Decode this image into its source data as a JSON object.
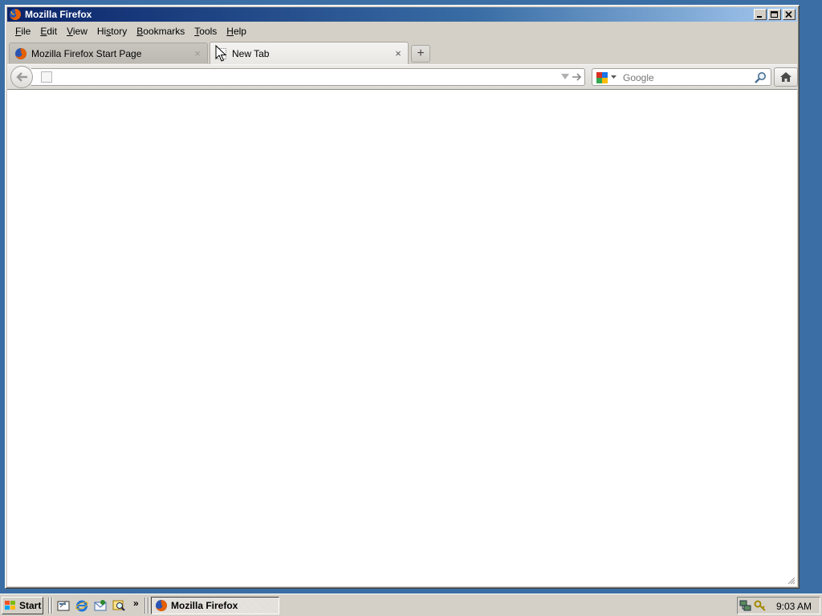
{
  "window": {
    "title": "Mozilla Firefox"
  },
  "menu": [
    {
      "pre": "",
      "u": "F",
      "post": "ile"
    },
    {
      "pre": "",
      "u": "E",
      "post": "dit"
    },
    {
      "pre": "",
      "u": "V",
      "post": "iew"
    },
    {
      "pre": "Hi",
      "u": "s",
      "post": "tory"
    },
    {
      "pre": "",
      "u": "B",
      "post": "ookmarks"
    },
    {
      "pre": "",
      "u": "T",
      "post": "ools"
    },
    {
      "pre": "",
      "u": "H",
      "post": "elp"
    }
  ],
  "tabs": [
    {
      "label": "Mozilla Firefox Start Page",
      "close": "×"
    },
    {
      "label": "New Tab",
      "close": "×"
    }
  ],
  "newtab_symbol": "+",
  "urlbar": {
    "value": ""
  },
  "searchbar": {
    "placeholder": "Google"
  },
  "taskbar": {
    "start_label": "Start",
    "more_symbol": "»",
    "task_label": "Mozilla Firefox",
    "clock": "9:03 AM"
  },
  "colors": {
    "title_gradient_start": "#0a246a",
    "title_gradient_end": "#a6caf0",
    "chrome": "#d4d0c8",
    "desktop": "#3a6ea5"
  },
  "icons": {
    "app": "firefox-icon",
    "back": "back-arrow-icon",
    "home": "home-icon",
    "search": "magnifier-icon",
    "engine": "google-icon"
  }
}
